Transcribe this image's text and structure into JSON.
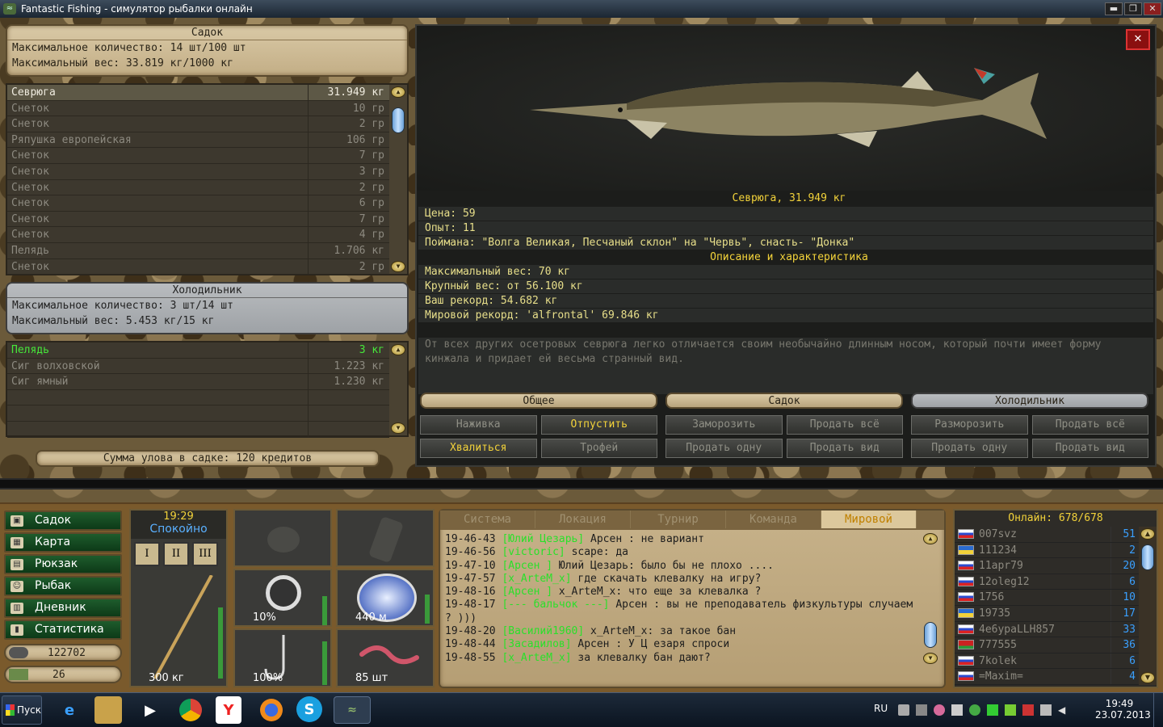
{
  "window": {
    "title": "Fantastic Fishing - симулятор рыбалки онлайн",
    "minimize": "▬",
    "restore": "❐",
    "close": "✕"
  },
  "sadok": {
    "title": "Садок",
    "max_count": "Максимальное количество: 14 шт/100 шт",
    "max_weight": "Максимальный вес: 33.819 кг/1000 кг",
    "items": [
      {
        "name": "Севрюга",
        "weight": "31.949 кг"
      },
      {
        "name": "Снеток",
        "weight": "10 гр"
      },
      {
        "name": "Снеток",
        "weight": "2 гр"
      },
      {
        "name": "Ряпушка европейская",
        "weight": "106 гр"
      },
      {
        "name": "Снеток",
        "weight": "7 гр"
      },
      {
        "name": "Снеток",
        "weight": "3 гр"
      },
      {
        "name": "Снеток",
        "weight": "2 гр"
      },
      {
        "name": "Снеток",
        "weight": "6 гр"
      },
      {
        "name": "Снеток",
        "weight": "7 гр"
      },
      {
        "name": "Снеток",
        "weight": "4 гр"
      },
      {
        "name": "Пелядь",
        "weight": "1.706 кг"
      },
      {
        "name": "Снеток",
        "weight": "2 гр"
      }
    ]
  },
  "fridge": {
    "title": "Холодильник",
    "max_count": "Максимальное количество: 3 шт/14 шт",
    "max_weight": "Максимальный вес: 5.453 кг/15 кг",
    "items": [
      {
        "name": "Пелядь",
        "weight": "3 кг"
      },
      {
        "name": "Сиг волховской",
        "weight": "1.223 кг"
      },
      {
        "name": "Сиг ямный",
        "weight": "1.230 кг"
      }
    ]
  },
  "total": "Сумма улова в садке: 120 кредитов",
  "detail": {
    "fish_title": "Севрюга, 31.949 кг",
    "price": "Цена: 59",
    "exp": "Опыт: 11",
    "caught": "Поймана: \"Волга Великая, Песчаный склон\" на \"Червь\", снасть- \"Донка\"",
    "desc_title": "Описание и характеристика",
    "max_weight": "Максимальный вес: 70 кг",
    "big_weight": "Крупный вес: от 56.100 кг",
    "your_record": "Ваш рекорд: 54.682 кг",
    "world_record": "Мировой рекорд: 'alfrontal' 69.846 кг",
    "description": "От всех других осетровых севрюга легко отличается своим необычайно длинным носом, который почти имеет форму кинжала и придает ей весьма странный вид.",
    "close": "✕"
  },
  "actions": {
    "general": {
      "title": "Общее",
      "b1": "Наживка",
      "b2": "Отпустить",
      "b3": "Хвалиться",
      "b4": "Трофей"
    },
    "sadok": {
      "title": "Садок",
      "b1": "Заморозить",
      "b2": "Продать всё",
      "b3": "Продать одну",
      "b4": "Продать вид"
    },
    "fridge": {
      "title": "Холодильник",
      "b1": "Разморозить",
      "b2": "Продать всё",
      "b3": "Продать одну",
      "b4": "Продать вид"
    }
  },
  "nav": [
    "Садок",
    "Карта",
    "Рюкзак",
    "Рыбак",
    "Дневник",
    "Статистика"
  ],
  "money": "122702",
  "gold": "26",
  "status": {
    "time": "19:29",
    "state": "Спокойно",
    "rod_ranks": [
      "I",
      "II",
      "III"
    ],
    "rod_load": "300 кг"
  },
  "tiles": {
    "reel": "10%",
    "line": "440 м",
    "hook": "100%",
    "bait": "85 шт"
  },
  "chat": {
    "tabs": [
      "Система",
      "Локация",
      "Турнир",
      "Команда",
      "Мировой"
    ],
    "messages": [
      {
        "t": "19-46-43",
        "n": "[Юлий Цезарь]",
        "m": "Арсен : не вариант"
      },
      {
        "t": "19-46-56",
        "n": "[victoric]",
        "m": "scape: да"
      },
      {
        "t": "19-47-10",
        "n": "[Арсен ]",
        "m": "Юлий Цезарь:  было бы не плохо ...."
      },
      {
        "t": "19-47-57",
        "n": "[x_ArteM_x]",
        "m": "где скачать клевалку на игру?"
      },
      {
        "t": "19-48-16",
        "n": "[Арсен ]",
        "m": "x_ArteM_x: что еще за клевалка ?"
      },
      {
        "t": "19-48-17",
        "n": "[--- бальчок ---]",
        "m": "Арсен : вы не преподаватель физкультуры случаем ? )))"
      },
      {
        "t": "19-48-20",
        "n": "[Василий1960]",
        "m": "x_ArteM_x: за такое бан"
      },
      {
        "t": "19-48-44",
        "n": "[Засадилов]",
        "m": "Арсен :  У Ц езаря спроси"
      },
      {
        "t": "19-48-55",
        "n": "[x_ArteM_x]",
        "m": "за клевалку бан дают?"
      }
    ]
  },
  "online": {
    "title": "Онлайн: 678/678",
    "users": [
      {
        "u": "007svz",
        "l": "51",
        "flag": "ru"
      },
      {
        "u": "111234",
        "l": "2",
        "flag": "ua"
      },
      {
        "u": "11apr79",
        "l": "20",
        "flag": "ru"
      },
      {
        "u": "12oleg12",
        "l": "6",
        "flag": "ru"
      },
      {
        "u": "1756",
        "l": "10",
        "flag": "ru"
      },
      {
        "u": "19735",
        "l": "17",
        "flag": "ua"
      },
      {
        "u": "4e6ypaLLH857",
        "l": "33",
        "flag": "ru"
      },
      {
        "u": "777555",
        "l": "36",
        "flag": "by"
      },
      {
        "u": "7kolek",
        "l": "6",
        "flag": "ru"
      },
      {
        "u": "=Maxim=",
        "l": "4",
        "flag": "ru"
      }
    ]
  },
  "taskbar": {
    "start": "Пуск",
    "lang": "RU",
    "time": "19:49",
    "date": "23.07.2013"
  },
  "colors": {
    "green": "#46e83a",
    "gold": "#f2d23a",
    "chat_name": "#2ae02a",
    "level": "#3aa0ff"
  }
}
